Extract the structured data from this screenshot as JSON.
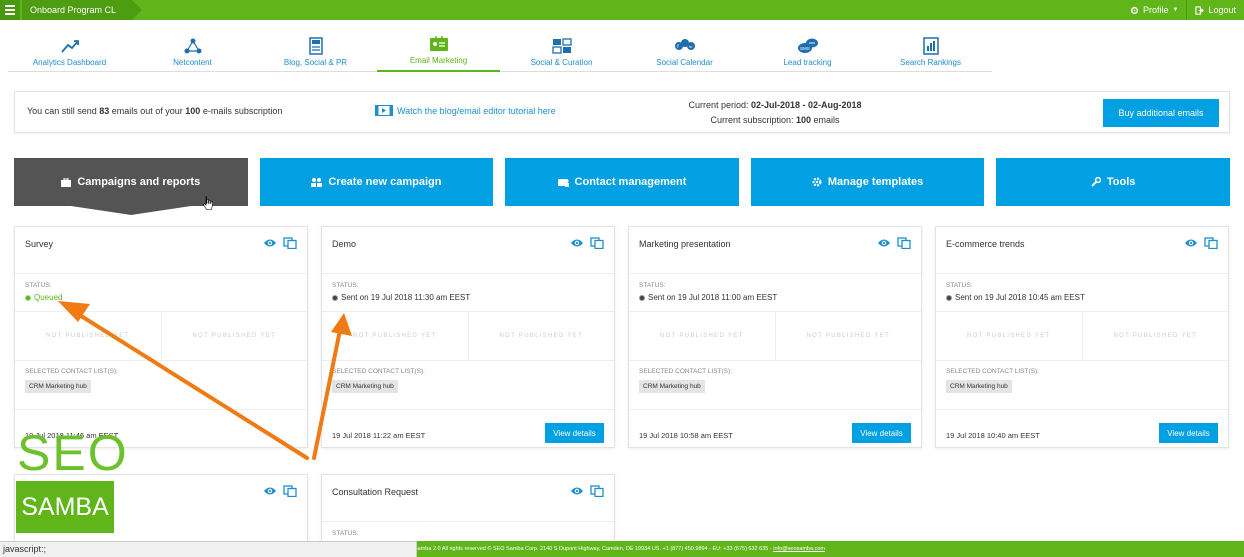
{
  "topbar": {
    "program": "Onboard Program CL",
    "profile": "Profile",
    "logout": "Logout"
  },
  "tabs": [
    {
      "label": "Analytics Dashboard",
      "icon": "chart-line-icon"
    },
    {
      "label": "Netcontent",
      "icon": "network-icon"
    },
    {
      "label": "Blog, Social & PR",
      "icon": "document-icon"
    },
    {
      "label": "Email Marketing",
      "icon": "email-card-icon",
      "active": true
    },
    {
      "label": "Social & Curation",
      "icon": "curation-icon"
    },
    {
      "label": "Social Calendar",
      "icon": "social-networks-icon"
    },
    {
      "label": "Lead tracking",
      "icon": "sms-bubble-icon"
    },
    {
      "label": "Search Rankings",
      "icon": "rankings-icon"
    }
  ],
  "info": {
    "send_prefix": "You can still send ",
    "send_count": "83",
    "send_middle": " emails out of your ",
    "send_total": "100",
    "send_suffix": " e-mails subscription",
    "tutorial": "Watch the blog/email editor tutorial here",
    "period_label": "Current period: ",
    "period_value": "02-Jul-2018 - 02-Aug-2018",
    "subscription_label": "Current subscription: ",
    "subscription_value": "100",
    "subscription_suffix": " emails",
    "buy_button": "Buy additional emails"
  },
  "actions": [
    {
      "label": "Campaigns and reports",
      "icon": "briefcase-icon",
      "active": true
    },
    {
      "label": "Create new campaign",
      "icon": "users-icon"
    },
    {
      "label": "Contact management",
      "icon": "contacts-icon"
    },
    {
      "label": "Manage templates",
      "icon": "gear-icon"
    },
    {
      "label": "Tools",
      "icon": "wrench-icon"
    }
  ],
  "card_labels": {
    "status": "STATUS:",
    "not_published": "NOT PUBLISHED YET",
    "contact_lists": "SELECTED CONTACT LIST(S):",
    "view_details": "View details"
  },
  "cards": [
    {
      "title": "Survey",
      "status": "Queued",
      "status_type": "queued",
      "list": "CRM Marketing hub",
      "date": "19 Jul 2018 11:46 am EEST"
    },
    {
      "title": "Demo",
      "status": "Sent on 19 Jul 2018 11:30 am EEST",
      "status_type": "sent",
      "list": "CRM Marketing hub",
      "date": "19 Jul 2018 11:22 am EEST"
    },
    {
      "title": "Marketing presentation",
      "status": "Sent on 19 Jul 2018 11:00 am EEST",
      "status_type": "sent",
      "list": "CRM Marketing hub",
      "date": "19 Jul 2018 10:58 am EEST"
    },
    {
      "title": "E-commerce trends",
      "status": "Sent on 19 Jul 2018 10:45 am EEST",
      "status_type": "sent",
      "list": "CRM Marketing hub",
      "date": "19 Jul 2018 10:40 am EEST"
    },
    {
      "title": "",
      "status": "",
      "status_type": "",
      "list": "",
      "date": ""
    },
    {
      "title": "Consultation Request",
      "status": "",
      "status_type": "",
      "list": "",
      "date": ""
    }
  ],
  "footer": {
    "text": "Samba 2.0  All rights reserved © SEO Samba Corp. 2140 S Dupont Highway, Camden, DE 19934 US. +1 (877) 450.9894 - EU: +33 (675) 632 635 - ",
    "email": "info@seosamba.com"
  },
  "statusbar": "javascript:;",
  "logo": {
    "seo": "SEO",
    "samba": "SAMBA"
  },
  "colors": {
    "green": "#5fb51a",
    "blue": "#00a0e3",
    "dark": "#545454",
    "arrow": "#f07a14"
  }
}
